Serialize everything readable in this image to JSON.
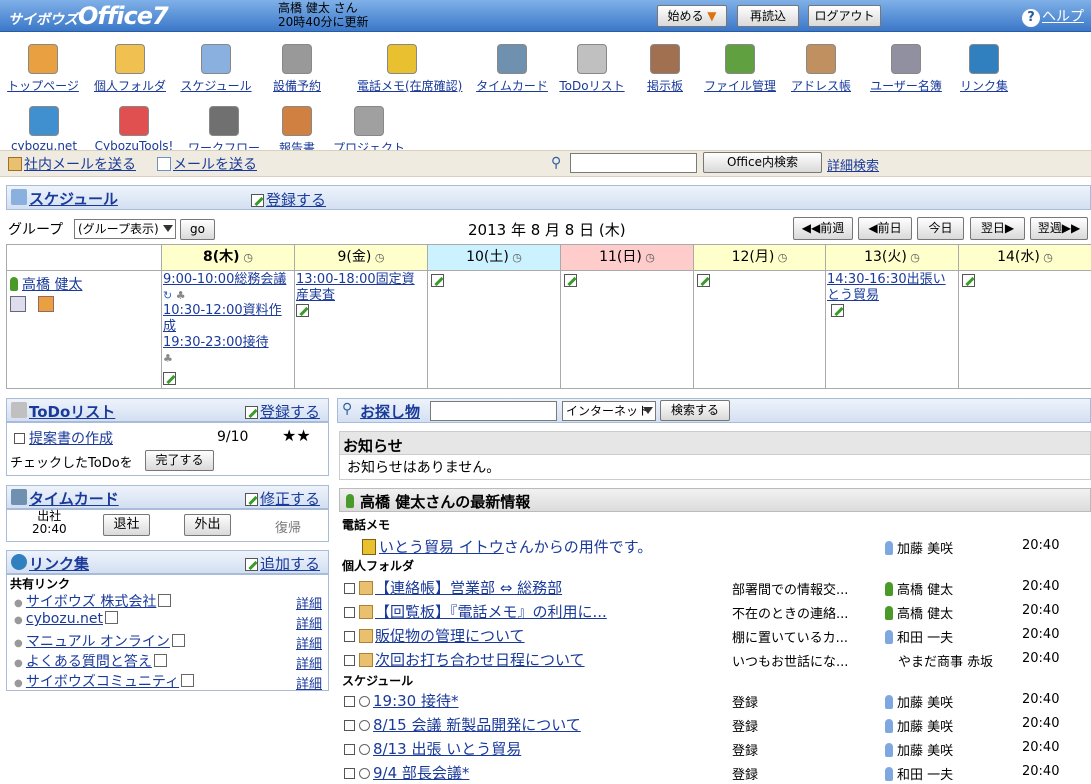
{
  "header": {
    "logo_small": "サイボウズ",
    "logo_big": "Office7",
    "user_name": "高橋 健太 さん",
    "updated": "20時40分に更新",
    "start_label": "始める",
    "reload_label": "再読込",
    "logout_label": "ログアウト",
    "help_label": "ヘルプ"
  },
  "apps": [
    {
      "label": "トップページ",
      "icon": "home-icon",
      "color": "#e8a040"
    },
    {
      "label": "個人フォルダ",
      "icon": "folder-icon",
      "color": "#f0c050"
    },
    {
      "label": "スケジュール",
      "icon": "schedule-icon",
      "color": "#8ab0e0"
    },
    {
      "label": "設備予約",
      "icon": "facility-icon",
      "color": "#999999"
    },
    {
      "label": "電話メモ(在席確認)",
      "icon": "phone-memo-icon",
      "color": "#e8c030"
    },
    {
      "label": "タイムカード",
      "icon": "timecard-icon",
      "color": "#7090b0"
    },
    {
      "label": "ToDoリスト",
      "icon": "todo-icon",
      "color": "#c0c0c0"
    },
    {
      "label": "掲示板",
      "icon": "bulletin-icon",
      "color": "#a07050"
    },
    {
      "label": "ファイル管理",
      "icon": "file-icon",
      "color": "#60a040"
    },
    {
      "label": "アドレス帳",
      "icon": "address-book-icon",
      "color": "#c09060"
    },
    {
      "label": "ユーザー名簿",
      "icon": "user-list-icon",
      "color": "#9090a0"
    },
    {
      "label": "リンク集",
      "icon": "links-icon",
      "color": "#3080c0"
    },
    {
      "label": "cybozu.net",
      "icon": "cybozu-net-icon",
      "color": "#4090d0"
    },
    {
      "label": "CybozuTools!",
      "icon": "tools-icon",
      "color": "#e05050"
    },
    {
      "label": "ワークフロー",
      "icon": "workflow-icon",
      "color": "#707070"
    },
    {
      "label": "報告書",
      "icon": "report-icon",
      "color": "#d08040"
    },
    {
      "label": "プロジェクト",
      "icon": "project-icon",
      "color": "#a0a0a0"
    }
  ],
  "toolbar": {
    "internal_mail": "社内メールを送る",
    "mail": "メールを送る",
    "search_button": "Office内検索",
    "advanced_search": "詳細検索"
  },
  "schedule": {
    "title": "スケジュール",
    "register": "登録する",
    "group_label": "グループ",
    "group_value": "(グループ表示)",
    "go": "go",
    "date": "2013 年 8 月 8 日 (木)",
    "prev_week": "◀◀前週",
    "prev_day": "◀前日",
    "today": "今日",
    "next_day": "翌日▶",
    "next_week": "翌週▶▶",
    "days": [
      {
        "label": "8(木)",
        "bg": "#ffffcc"
      },
      {
        "label": "9(金)",
        "bg": "#ffffcc"
      },
      {
        "label": "10(土)",
        "bg": "#ccf2ff"
      },
      {
        "label": "11(日)",
        "bg": "#ffcccc"
      },
      {
        "label": "12(月)",
        "bg": "#ffffcc"
      },
      {
        "label": "13(火)",
        "bg": "#ffffcc"
      },
      {
        "label": "14(水)",
        "bg": "#ffffcc"
      }
    ],
    "user": "高橋 健太",
    "events": {
      "d0": [
        "9:00-10:00総務会議",
        "10:30-12:00資料作成",
        "19:30-23:00接待"
      ],
      "d1": [
        "13:00-18:00固定資産実査"
      ],
      "d5": [
        "14:30-16:30出張いとう貿易"
      ]
    }
  },
  "todo": {
    "title": "ToDoリスト",
    "register": "登録する",
    "item": "提案書の作成",
    "due": "9/10",
    "stars": "★★",
    "check_text": "チェックしたToDoを",
    "done_button": "完了する"
  },
  "timecard": {
    "title": "タイムカード",
    "edit": "修正する",
    "in_label": "出社",
    "in_time": "20:40",
    "out": "退社",
    "away": "外出",
    "back": "復帰"
  },
  "links": {
    "title": "リンク集",
    "add": "追加する",
    "shared": "共有リンク",
    "detail": "詳細",
    "items": [
      "サイボウズ 株式会社",
      "cybozu.net",
      "マニュアル オンライン",
      "よくある質問と答え",
      "サイボウズコミュニティ"
    ]
  },
  "search": {
    "title": "お探し物",
    "scope": "インターネット",
    "button": "検索する"
  },
  "notice": {
    "title": "お知らせ",
    "text": "お知らせはありません。"
  },
  "latest": {
    "title": "高橋 健太さんの最新情報",
    "phone_section": "電話メモ",
    "phone_item": "いとう貿易 イトウ",
    "phone_suffix": "さんからの用件です。",
    "phone_user": "加藤 美咲",
    "phone_time": "20:40",
    "folder_section": "個人フォルダ",
    "folders": [
      {
        "title": "【連絡帳】営業部 ⇔ 総務部",
        "desc": "部署間での情報交...",
        "user": "高橋 健太",
        "ucolor": "g",
        "time": "20:40"
      },
      {
        "title": "【回覧板】『電話メモ』の利用に...",
        "desc": "不在のときの連絡...",
        "user": "高橋 健太",
        "ucolor": "g",
        "time": "20:40"
      },
      {
        "title": "販促物の管理について",
        "desc": "棚に置いているカ...",
        "user": "和田 一夫",
        "ucolor": "b",
        "time": "20:40"
      },
      {
        "title": "次回お打ち合わせ日程について",
        "desc": "いつもお世話にな...",
        "user": "やまだ商事 赤坂",
        "ucolor": "",
        "time": "20:40"
      }
    ],
    "sched_section": "スケジュール",
    "scheds": [
      {
        "title": "19:30 接待*",
        "desc": "登録",
        "user": "加藤 美咲",
        "time": "20:40"
      },
      {
        "title": "8/15 会議 新製品開発について",
        "desc": "登録",
        "user": "加藤 美咲",
        "time": "20:40"
      },
      {
        "title": "8/13 出張 いとう貿易",
        "desc": "登録",
        "user": "加藤 美咲",
        "time": "20:40"
      },
      {
        "title": "9/4 部長会議*",
        "desc": "登録",
        "user": "和田 一夫",
        "time": "20:40"
      }
    ]
  }
}
